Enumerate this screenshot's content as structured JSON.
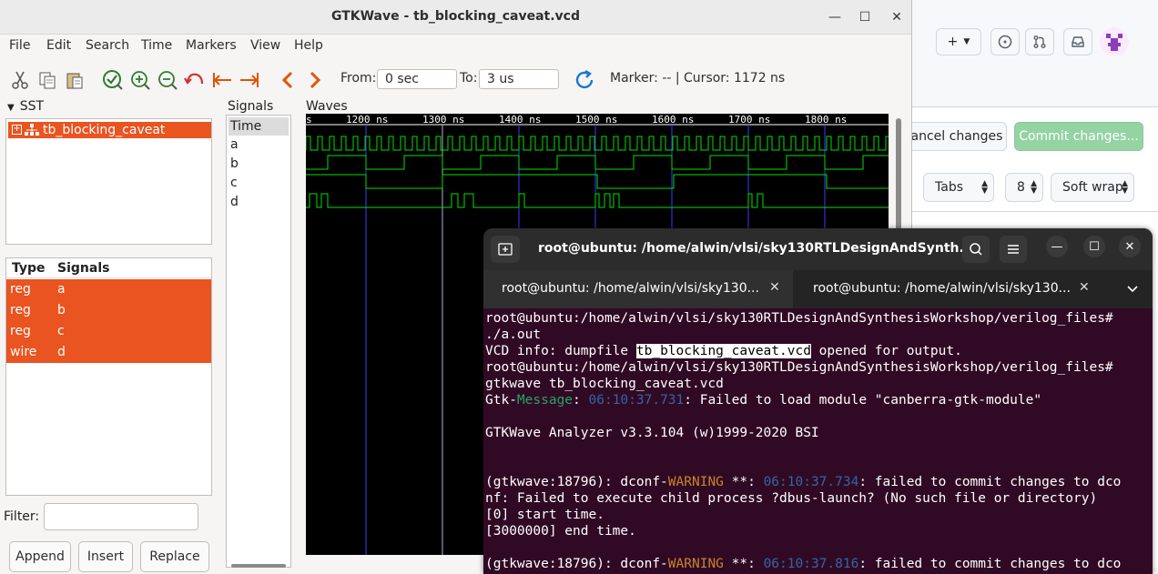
{
  "browser": {
    "cancel_label": "ancel changes",
    "commit_label": "Commit changes...",
    "indent_mode": "Tabs",
    "indent_size": "8",
    "wrap_mode": "Soft wrap"
  },
  "gtkwave": {
    "title": "GTKWave - tb_blocking_caveat.vcd",
    "menu": [
      "File",
      "Edit",
      "Search",
      "Time",
      "Markers",
      "View",
      "Help"
    ],
    "from_label": "From:",
    "from_value": "0 sec",
    "to_label": "To:",
    "to_value": "3 us",
    "marker_text": "Marker: --  |  Cursor: 1172 ns",
    "sst_label": "SST",
    "sst_item": "tb_blocking_caveat",
    "type_header": "Type",
    "signals_header": "Signals",
    "type_rows": [
      {
        "type": "reg",
        "name": "a"
      },
      {
        "type": "reg",
        "name": "b"
      },
      {
        "type": "reg",
        "name": "c"
      },
      {
        "type": "wire",
        "name": "d"
      }
    ],
    "filter_label": "Filter:",
    "append_label": "Append",
    "insert_label": "Insert",
    "replace_label": "Replace",
    "signals_label": "Signals",
    "waves_label": "Waves",
    "signal_list": [
      "Time",
      "a",
      "b",
      "c",
      "d"
    ],
    "time_ticks": [
      "s",
      "1200 ns",
      "1300 ns",
      "1400 ns",
      "1500 ns",
      "1600 ns",
      "1700 ns",
      "1800 ns"
    ]
  },
  "terminal": {
    "title": "root@ubuntu: /home/alwin/vlsi/sky130RTLDesignAndSynth...",
    "tab1": "root@ubuntu: /home/alwin/vlsi/sky130...",
    "tab2": "root@ubuntu: /home/alwin/vlsi/sky130...",
    "line1": "root@ubuntu:/home/alwin/vlsi/sky130RTLDesignAndSynthesisWorkshop/verilog_files#",
    "line2": "./a.out",
    "line3a": "VCD info: dumpfile ",
    "line3b": "tb_blocking_caveat.vcd",
    "line3c": " opened for output.",
    "line4": "root@ubuntu:/home/alwin/vlsi/sky130RTLDesignAndSynthesisWorkshop/verilog_files#",
    "line5": "gtkwave tb_blocking_caveat.vcd",
    "line6a": "Gtk-",
    "line6b": "Message",
    "line6c": ": ",
    "line6d": "06:10:37.731",
    "line6e": ": Failed to load module \"canberra-gtk-module\"",
    "line7": "GTKWave Analyzer v3.3.104 (w)1999-2020 BSI",
    "line8a": "(gtkwave:18796): dconf-",
    "line8b": "WARNING",
    "line8c": " **: ",
    "line8d": "06:10:37.734",
    "line8e": ": failed to commit changes to dco",
    "line9": "nf: Failed to execute child process ?dbus-launch? (No such file or directory)",
    "line10": "[0] start time.",
    "line11": "[3000000] end time.",
    "line12a": "(gtkwave:18796): dconf-",
    "line12b": "WARNING",
    "line12c": " **: ",
    "line12d": "06:10:37.816",
    "line12e": ": failed to commit changes to dco"
  }
}
